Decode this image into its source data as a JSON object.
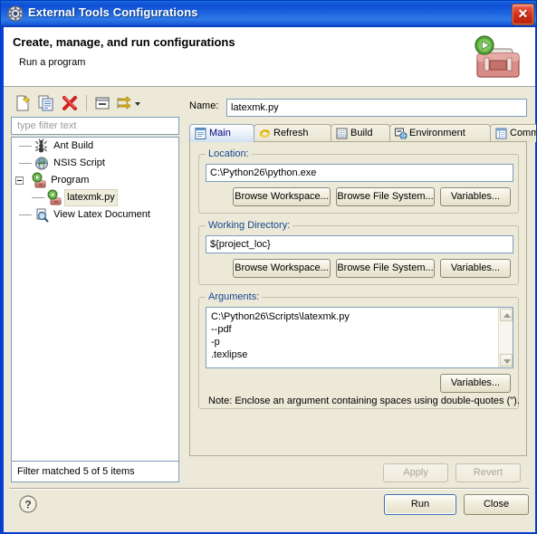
{
  "window": {
    "title": "External Tools Configurations",
    "icon": "gear-icon",
    "close_label": "✕"
  },
  "header": {
    "title": "Create, manage, and run configurations",
    "subtitle": "Run a program",
    "icon": "toolbox-run-icon"
  },
  "left_panel": {
    "toolbar": [
      {
        "name": "new-configuration-button",
        "icon": "new-document-icon"
      },
      {
        "name": "duplicate-configuration-button",
        "icon": "copy-icon"
      },
      {
        "name": "delete-configuration-button",
        "icon": "red-x-icon"
      },
      {
        "name": "collapse-all-button",
        "icon": "collapse-all-icon"
      },
      {
        "name": "filter-configurations-button",
        "icon": "filter-icon"
      },
      {
        "name": "filter-dropdown-arrow",
        "icon": "chevron-down-icon"
      }
    ],
    "filter": {
      "placeholder": "type filter text",
      "value": ""
    },
    "tree": [
      {
        "label": "Ant Build",
        "icon": "ant-icon",
        "depth": 0,
        "expander": "none",
        "selected": false
      },
      {
        "label": "NSIS Script",
        "icon": "nsis-icon",
        "depth": 0,
        "expander": "none",
        "selected": false
      },
      {
        "label": "Program",
        "icon": "program-icon",
        "depth": 0,
        "expander": "expanded",
        "selected": false
      },
      {
        "label": "latexmk.py",
        "icon": "program-icon",
        "depth": 1,
        "expander": "none",
        "selected": true
      },
      {
        "label": "View Latex Document",
        "icon": "view-document-icon",
        "depth": 0,
        "expander": "none",
        "selected": false
      }
    ],
    "status": "Filter matched 5 of 5 items"
  },
  "right_panel": {
    "name_label": "Name:",
    "name_value": "latexmk.py",
    "tabs": [
      {
        "label": "Main",
        "icon": "main-tab-icon",
        "active": true
      },
      {
        "label": "Refresh",
        "icon": "refresh-tab-icon",
        "active": false
      },
      {
        "label": "Build",
        "icon": "build-tab-icon",
        "active": false
      },
      {
        "label": "Environment",
        "icon": "environment-tab-icon",
        "active": false
      },
      {
        "label": "Common",
        "icon": "common-tab-icon",
        "active": false
      }
    ],
    "location": {
      "group_title": "Location:",
      "value": "C:\\Python26\\python.exe",
      "browse_workspace": "Browse Workspace...",
      "browse_file_system": "Browse File System...",
      "variables": "Variables..."
    },
    "working_directory": {
      "group_title": "Working Directory:",
      "value": "${project_loc}",
      "browse_workspace": "Browse Workspace...",
      "browse_file_system": "Browse File System...",
      "variables": "Variables..."
    },
    "arguments": {
      "group_title": "Arguments:",
      "value": "C:\\Python26\\Scripts\\latexmk.py\n--pdf\n-p\n.texlipse",
      "variables": "Variables...",
      "note": "Note: Enclose an argument containing spaces using double-quotes (\")."
    },
    "apply_label": "Apply",
    "revert_label": "Revert"
  },
  "footer": {
    "help_icon": "help-icon",
    "run_label": "Run",
    "close_label": "Close"
  },
  "colors": {
    "titlebar_blue": "#0e4fd4",
    "dialog_bg": "#ece9d8",
    "group_label": "#154890",
    "selection": "#efeedd",
    "accent_red": "#cf2a15"
  }
}
